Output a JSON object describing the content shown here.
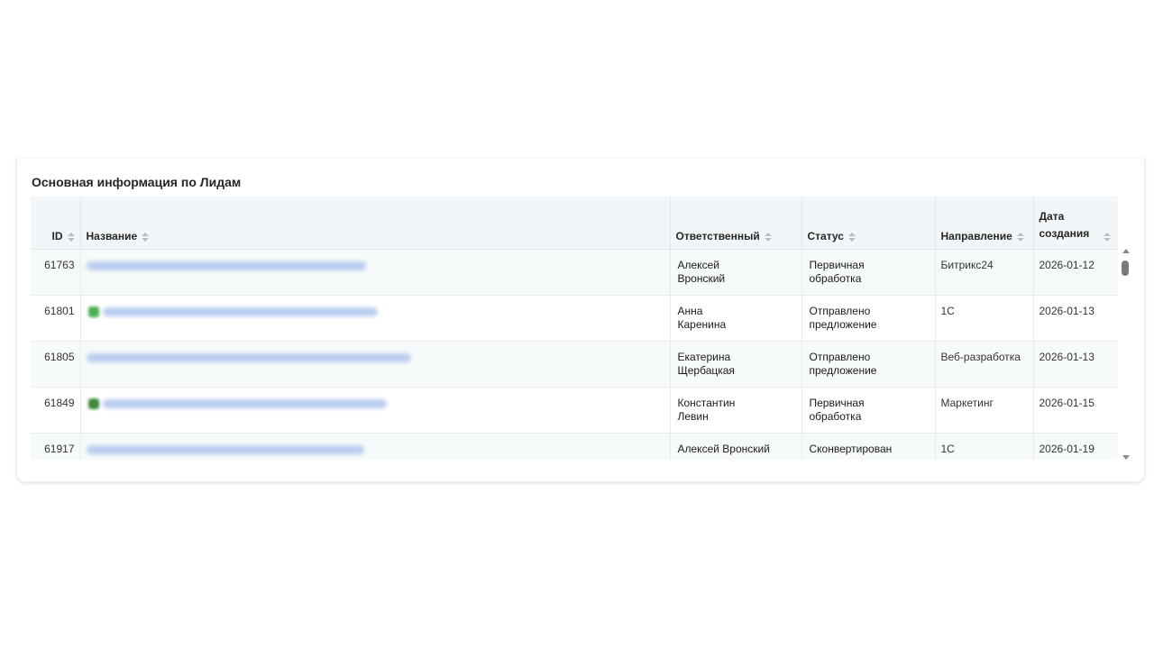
{
  "panel": {
    "title": "Основная информация по Лидам"
  },
  "columns": {
    "id": "ID",
    "name": "Название",
    "responsible": "Ответственный",
    "status": "Статус",
    "direction": "Направление",
    "date_line1": "Дата",
    "date_line2": "создания"
  },
  "rows": [
    {
      "id": "61763",
      "responsible": "Алексей\nВронский",
      "status": "Первичная\nобработка",
      "direction": "Битрикс24",
      "date": "2026-01-12"
    },
    {
      "id": "61801",
      "responsible": "Анна\nКаренина",
      "status": "Отправлено\nпредложение",
      "direction": "1С",
      "date": "2026-01-13"
    },
    {
      "id": "61805",
      "responsible": "Екатерина\nЩербацкая",
      "status": "Отправлено\nпредложение",
      "direction": "Веб-разработка",
      "date": "2026-01-13"
    },
    {
      "id": "61849",
      "responsible": "Константин\nЛевин",
      "status": "Первичная\nобработка",
      "direction": "Маркетинг",
      "date": "2026-01-15"
    },
    {
      "id": "61917",
      "responsible": "Алексей Вронский",
      "status": "Сконвертирован",
      "direction": "1С",
      "date": "2026-01-19"
    }
  ],
  "colors": {
    "header_bg": "#f2f6f8",
    "row_alt_bg": "#f7fafa",
    "link_blurred": "#b9cdf0"
  },
  "icons": {
    "sort": "sort-icon",
    "scroll_up": "scroll-up-arrow-icon",
    "scroll_down": "scroll-down-arrow-icon"
  }
}
